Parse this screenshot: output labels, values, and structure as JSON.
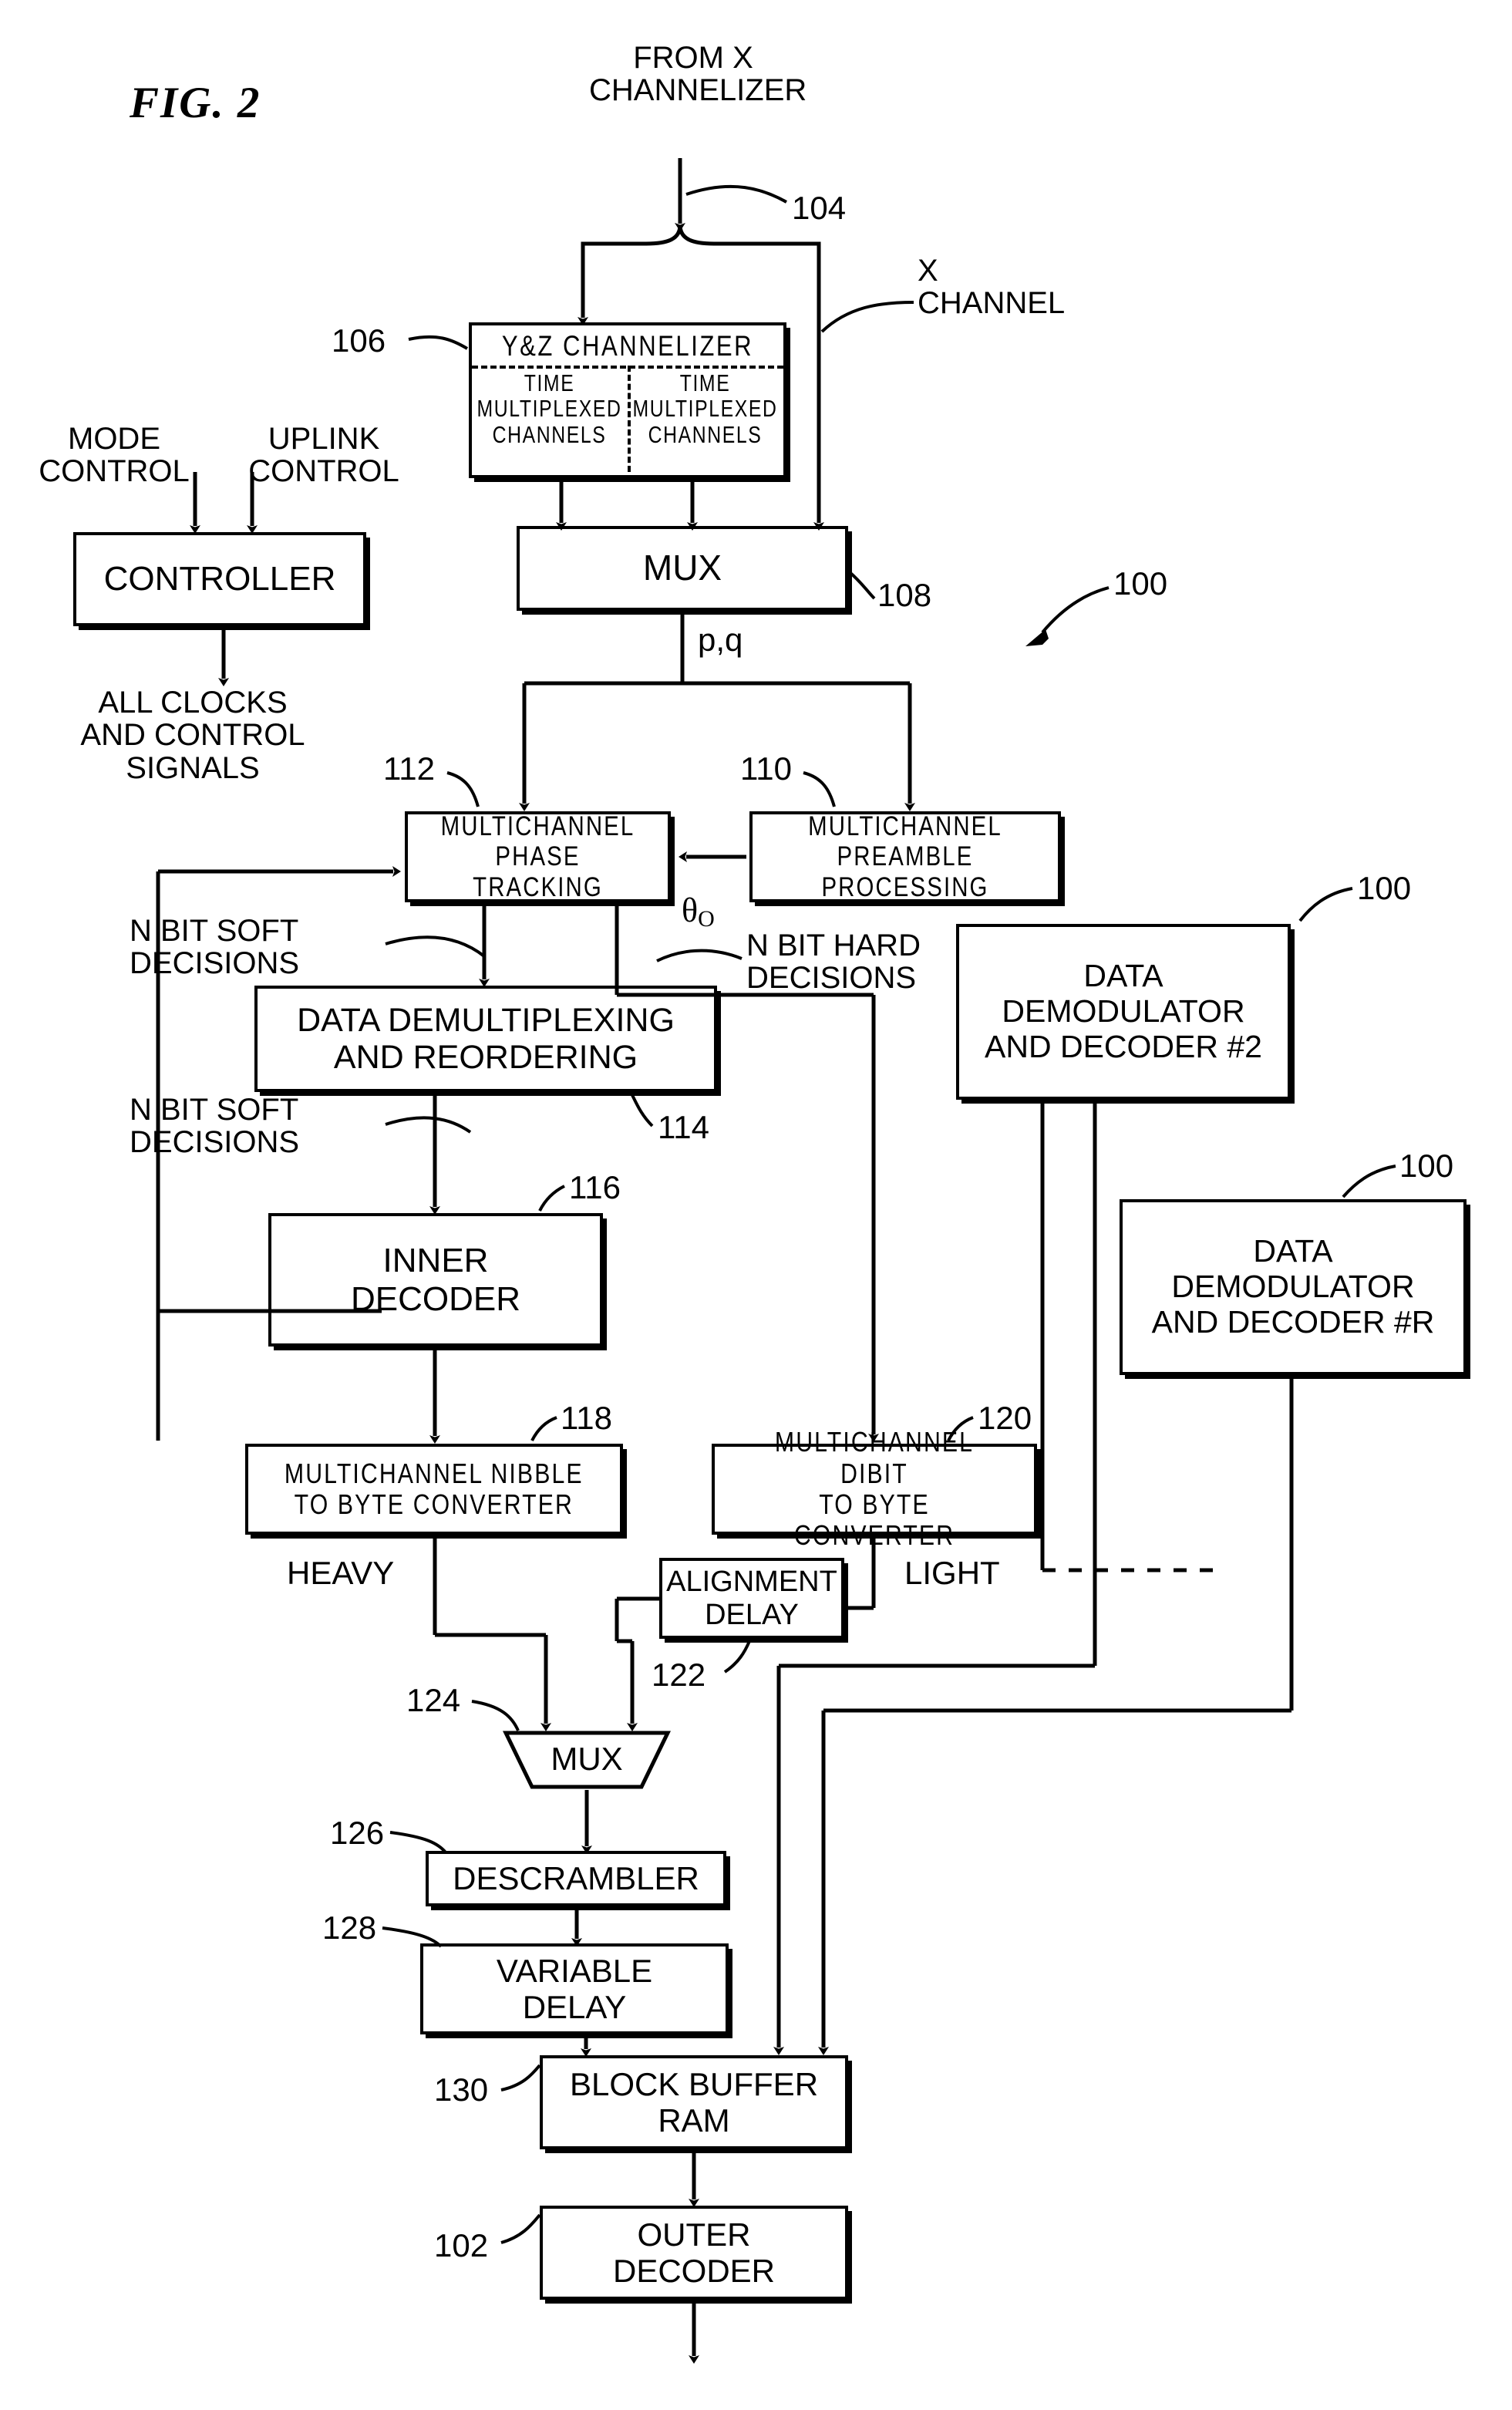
{
  "figure": {
    "label": "FIG. 2",
    "system_ref": "100"
  },
  "io_labels": {
    "from_x_channelizer": "FROM X\nCHANNELIZER",
    "x_channel": "X\nCHANNEL",
    "mode_control": "MODE\nCONTROL",
    "uplink_control": "UPLINK\nCONTROL",
    "all_clocks": "ALL CLOCKS\nAND CONTROL\nSIGNALS",
    "pq": "p,q",
    "theta": "θ",
    "theta_sub": "O",
    "n_bit_soft_1": "N BIT SOFT\nDECISIONS",
    "n_bit_soft_2": "N BIT SOFT\nDECISIONS",
    "n_bit_hard": "N BIT HARD\nDECISIONS",
    "heavy": "HEAVY",
    "light": "LIGHT"
  },
  "blocks": [
    {
      "id": "channelizer",
      "ref": "106",
      "title": "Y&Z CHANNELIZER",
      "left_cell": "TIME\nMULTIPLEXED\nCHANNELS",
      "right_cell": "TIME\nMULTIPLEXED\nCHANNELS"
    },
    {
      "id": "mux-top",
      "ref": "108",
      "label": "MUX"
    },
    {
      "id": "controller",
      "ref": "",
      "label": "CONTROLLER"
    },
    {
      "id": "phase-tracking",
      "ref": "112",
      "label": "MULTICHANNEL\nPHASE TRACKING"
    },
    {
      "id": "preamble",
      "ref": "110",
      "label": "MULTICHANNEL\nPREAMBLE PROCESSING"
    },
    {
      "id": "demux",
      "ref": "114",
      "label": "DATA DEMULTIPLEXING\nAND REORDERING"
    },
    {
      "id": "inner-decoder",
      "ref": "116",
      "label": "INNER\nDECODER"
    },
    {
      "id": "nibble",
      "ref": "118",
      "label": "MULTICHANNEL NIBBLE\nTO BYTE CONVERTER"
    },
    {
      "id": "dibit",
      "ref": "120",
      "label": "MULTICHANNEL DIBIT\nTO BYTE CONVERTER"
    },
    {
      "id": "alignment",
      "ref": "122",
      "label": "ALIGNMENT\nDELAY"
    },
    {
      "id": "mux-bottom",
      "ref": "124",
      "label": "MUX"
    },
    {
      "id": "descrambler",
      "ref": "126",
      "label": "DESCRAMBLER"
    },
    {
      "id": "variable-delay",
      "ref": "128",
      "label": "VARIABLE\nDELAY"
    },
    {
      "id": "block-buffer",
      "ref": "130",
      "label": "BLOCK BUFFER\nRAM"
    },
    {
      "id": "outer-decoder",
      "ref": "102",
      "label": "OUTER\nDECODER"
    },
    {
      "id": "demod2",
      "ref": "100",
      "label": "DATA\nDEMODULATOR\nAND DECODER #2"
    },
    {
      "id": "demodR",
      "ref": "100",
      "label": "DATA\nDEMODULATOR\nAND DECODER #R"
    }
  ],
  "reference_numerals": {
    "r104": "104",
    "r106": "106",
    "r108": "108",
    "r110": "110",
    "r112": "112",
    "r114": "114",
    "r116": "116",
    "r118": "118",
    "r120": "120",
    "r122": "122",
    "r124": "124",
    "r126": "126",
    "r128": "128",
    "r130": "130",
    "r102": "102",
    "r100a": "100",
    "r100b": "100",
    "r100c": "100"
  },
  "colors": {
    "ink": "#000000",
    "paper": "#ffffff"
  }
}
